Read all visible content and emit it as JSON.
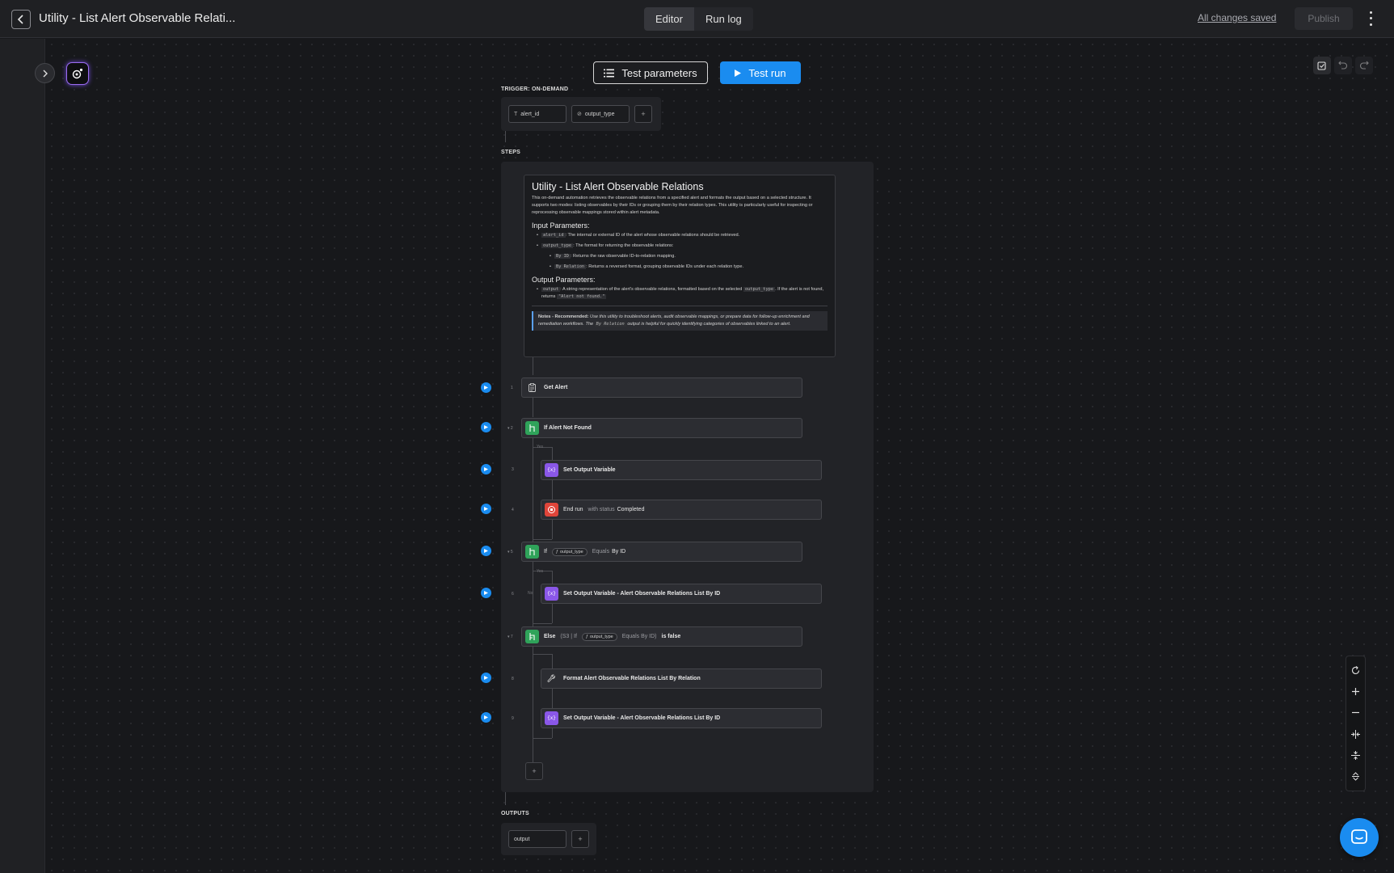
{
  "app": {
    "title": "Utility - List Alert Observable Relati...",
    "tabs": [
      {
        "label": "Editor",
        "active": true
      },
      {
        "label": "Run log",
        "active": false
      }
    ],
    "save_status": "All changes saved",
    "publish_label": "Publish"
  },
  "toolbar": {
    "test_parameters_label": "Test parameters",
    "test_run_label": "Test run"
  },
  "trigger": {
    "section_label": "TRIGGER: ON-DEMAND",
    "params": [
      {
        "name": "alert_id",
        "type_icon": "text-type-icon"
      },
      {
        "name": "output_type",
        "type_icon": "select-type-icon"
      }
    ],
    "add_label": "+"
  },
  "steps_section_label": "STEPS",
  "note": {
    "title": "Utility - List Alert Observable Relations",
    "intro": "This on-demand automation retrieves the observable relations from a specified alert and formats the output based on a selected structure. It supports two modes: listing observables by their IDs or grouping them by their relation types. This utility is particularly useful for inspecting or reprocessing observable mappings stored within alert metadata.",
    "input_heading": "Input Parameters:",
    "input_alert_code": "alert_id",
    "input_alert_text": ": The internal or external ID of the alert whose observable relations should be retrieved.",
    "input_output_code": "output_type",
    "input_output_text": ": The format for returning the observable relations:",
    "by_id_code": "By ID",
    "by_id_text": ": Returns the raw observable ID-to-relation mapping.",
    "by_relation_code": "By Relation",
    "by_relation_text": ": Returns a reversed format, grouping observable IDs under each relation type.",
    "output_heading": "Output Parameters:",
    "output_code": "output",
    "output_text_1": ": A string representation of the alert's observable relations, formatted based on the selected",
    "output_type_code": "output_type",
    "output_text_2": ". If the alert is not found, returns",
    "not_found_code": "\"Alert not found.\"",
    "notes_bold": "Notes - Recommended:",
    "notes_text_1": " Use this utility to troubleshoot alerts, audit observable mappings, or prepare data for follow-up enrichment and remediation workflows. The",
    "notes_code": "By Relation",
    "notes_text_2": "output is helpful for quickly identifying categories of observables linked to an alert."
  },
  "steps": [
    {
      "num": "1",
      "label": "Get Alert"
    },
    {
      "num": "▾ 2",
      "label": "If Alert Not Found",
      "branch": "Yes"
    },
    {
      "num": "3",
      "label": "Set Output Variable"
    },
    {
      "num": "4",
      "label": "End run",
      "muted": "with status",
      "status": "Completed"
    },
    {
      "num": "▾ 5",
      "label": "If",
      "var": "output_type",
      "op": "Equals",
      "value": "By ID",
      "branch": "Yes"
    },
    {
      "num": "6",
      "label": "Set Output Variable - Alert Observable Relations List By ID",
      "no_label": "No"
    },
    {
      "num": "▾ 7",
      "label": "Else",
      "ref": "(S3 | If",
      "var": "output_type",
      "op": "Equals By ID)",
      "tail": "is false"
    },
    {
      "num": "8",
      "label": "Format Alert Observable Relations List By Relation"
    },
    {
      "num": "9",
      "label": "Set Output Variable - Alert Observable Relations List By ID"
    }
  ],
  "add_step_label": "+",
  "outputs": {
    "section_label": "OUTPUTS",
    "params": [
      {
        "name": "output"
      }
    ],
    "add_label": "+"
  },
  "colors": {
    "accent": "#1a8cf0",
    "condition": "#2fa35a",
    "variable": "#8a57e8",
    "end": "#e0453a"
  }
}
